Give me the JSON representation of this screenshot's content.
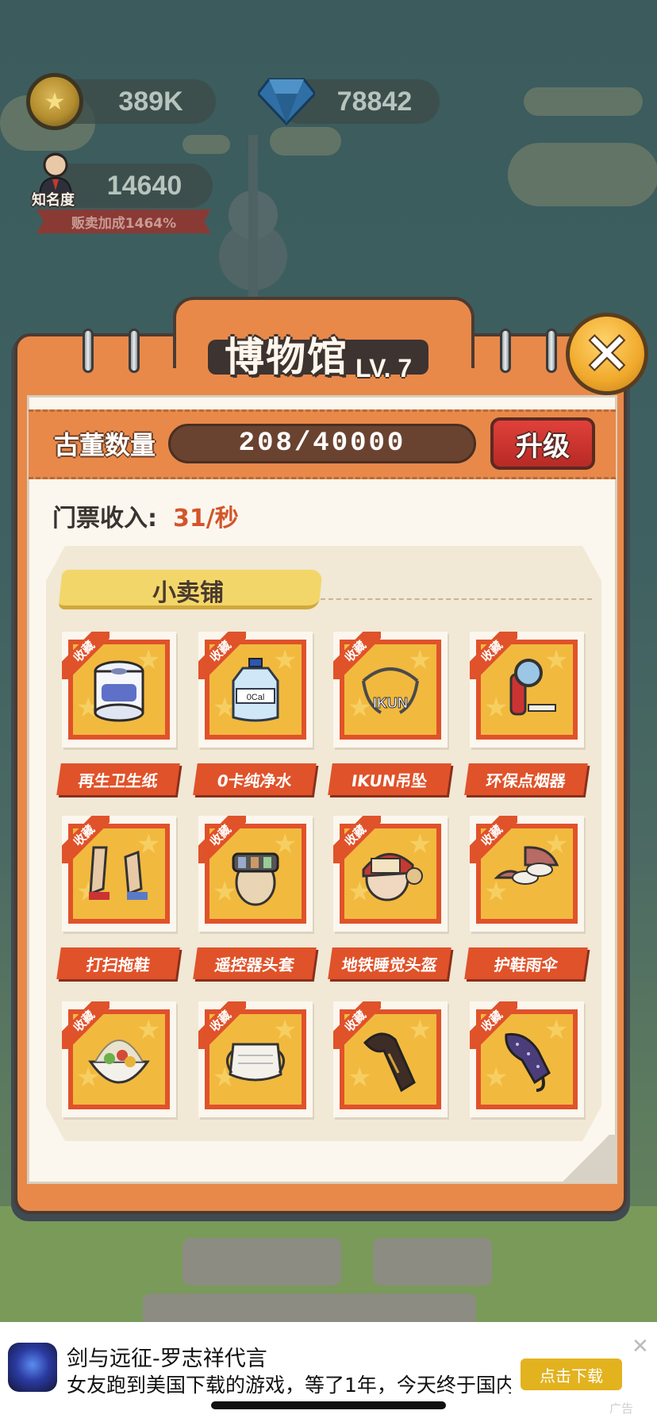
{
  "hud": {
    "coins": "389K",
    "gems": "78842",
    "fame": "14640",
    "fame_tag": "知名度",
    "sale_bonus": "贩卖加成1464%"
  },
  "museum": {
    "title": "博物馆",
    "level": "LV. 7",
    "count_label": "古董数量",
    "count_value": "208/40000",
    "upgrade_label": "升级",
    "income_label": "门票收入:",
    "income_value": "31/秒",
    "shop_title": "小卖铺",
    "collect_flag": "收藏",
    "items": [
      {
        "label": "再生卫生纸",
        "icon": "toilet-paper-icon"
      },
      {
        "label": "0卡纯净水",
        "icon": "water-bottle-icon"
      },
      {
        "label": "IKUN吊坠",
        "icon": "pendant-icon"
      },
      {
        "label": "环保点烟器",
        "icon": "lighter-icon"
      },
      {
        "label": "打扫拖鞋",
        "icon": "mop-slippers-icon"
      },
      {
        "label": "遥控器头套",
        "icon": "remote-headgear-icon"
      },
      {
        "label": "地铁睡觉头盔",
        "icon": "sleep-helmet-icon"
      },
      {
        "label": "护鞋雨伞",
        "icon": "shoe-umbrella-icon"
      },
      {
        "label": "",
        "icon": "dessert-bowl-icon"
      },
      {
        "label": "",
        "icon": "mask-icon"
      },
      {
        "label": "",
        "icon": "tie-icon"
      },
      {
        "label": "",
        "icon": "umbrella-icon"
      }
    ]
  },
  "ad": {
    "title": "剑与远征-罗志祥代言",
    "description": "女友跑到美国下载的游戏，等了1年，今天终于国内…",
    "button": "点击下载",
    "close": "✕",
    "tag": "广告"
  },
  "colors": {
    "panel": "#e8894a",
    "accent_red": "#e0522a",
    "item_bg": "#f2b93f",
    "income": "#d3552b"
  }
}
